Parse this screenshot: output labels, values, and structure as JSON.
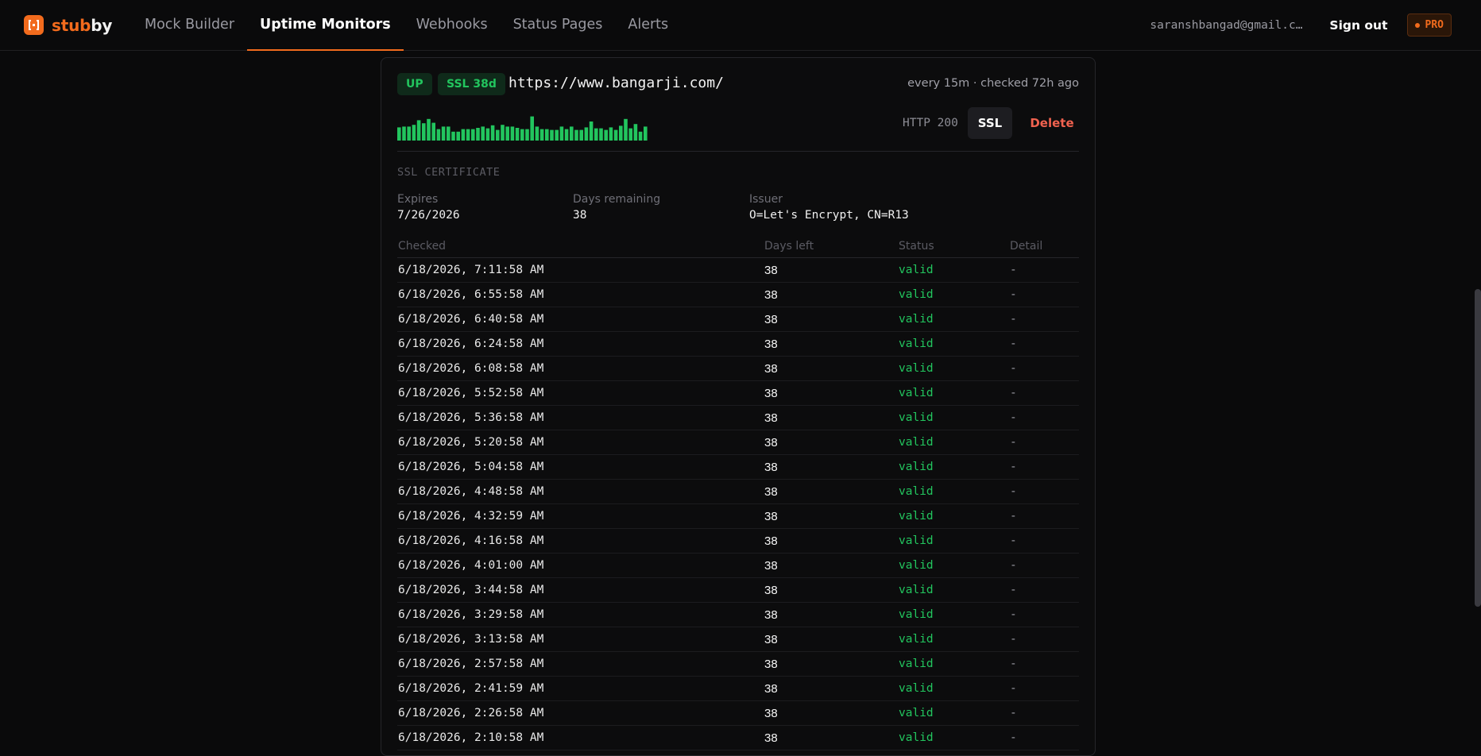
{
  "brand": {
    "part_a": "stub",
    "part_b": "by",
    "logo_icon": "bracket-logo-icon"
  },
  "nav": {
    "tabs": [
      {
        "label": "Mock Builder",
        "active": false
      },
      {
        "label": "Uptime Monitors",
        "active": true
      },
      {
        "label": "Webhooks",
        "active": false
      },
      {
        "label": "Status Pages",
        "active": false
      },
      {
        "label": "Alerts",
        "active": false
      }
    ]
  },
  "user": {
    "email": "saranshbangad@gmail.com",
    "signout_label": "Sign out",
    "plan_label": "PRO"
  },
  "monitor": {
    "status": "UP",
    "ssl_badge": "SSL 38d",
    "url": "https://www.bangarji.com/",
    "meta": "every 15m · checked 72h ago",
    "http_status": "HTTP 200",
    "ssl_button": "SSL",
    "delete_button": "Delete",
    "uptime_history": [
      0.52,
      0.55,
      0.55,
      0.62,
      0.8,
      0.68,
      0.85,
      0.7,
      0.45,
      0.55,
      0.55,
      0.35,
      0.35,
      0.45,
      0.45,
      0.45,
      0.5,
      0.55,
      0.48,
      0.6,
      0.42,
      0.62,
      0.55,
      0.55,
      0.5,
      0.45,
      0.45,
      0.95,
      0.55,
      0.45,
      0.45,
      0.42,
      0.42,
      0.55,
      0.45,
      0.55,
      0.42,
      0.42,
      0.52,
      0.75,
      0.48,
      0.48,
      0.42,
      0.52,
      0.42,
      0.58,
      0.85,
      0.48,
      0.65,
      0.35,
      0.55
    ]
  },
  "ssl": {
    "section_title": "SSL CERTIFICATE",
    "expires_label": "Expires",
    "expires_value": "7/26/2026",
    "days_label": "Days remaining",
    "days_value": "38",
    "issuer_label": "Issuer",
    "issuer_value": "O=Let's Encrypt, CN=R13"
  },
  "history": {
    "columns": [
      "Checked",
      "Days left",
      "Status",
      "Detail"
    ],
    "rows": [
      {
        "checked": "6/18/2026, 7:11:58 AM",
        "days": "38",
        "status": "valid",
        "detail": "-"
      },
      {
        "checked": "6/18/2026, 6:55:58 AM",
        "days": "38",
        "status": "valid",
        "detail": "-"
      },
      {
        "checked": "6/18/2026, 6:40:58 AM",
        "days": "38",
        "status": "valid",
        "detail": "-"
      },
      {
        "checked": "6/18/2026, 6:24:58 AM",
        "days": "38",
        "status": "valid",
        "detail": "-"
      },
      {
        "checked": "6/18/2026, 6:08:58 AM",
        "days": "38",
        "status": "valid",
        "detail": "-"
      },
      {
        "checked": "6/18/2026, 5:52:58 AM",
        "days": "38",
        "status": "valid",
        "detail": "-"
      },
      {
        "checked": "6/18/2026, 5:36:58 AM",
        "days": "38",
        "status": "valid",
        "detail": "-"
      },
      {
        "checked": "6/18/2026, 5:20:58 AM",
        "days": "38",
        "status": "valid",
        "detail": "-"
      },
      {
        "checked": "6/18/2026, 5:04:58 AM",
        "days": "38",
        "status": "valid",
        "detail": "-"
      },
      {
        "checked": "6/18/2026, 4:48:58 AM",
        "days": "38",
        "status": "valid",
        "detail": "-"
      },
      {
        "checked": "6/18/2026, 4:32:59 AM",
        "days": "38",
        "status": "valid",
        "detail": "-"
      },
      {
        "checked": "6/18/2026, 4:16:58 AM",
        "days": "38",
        "status": "valid",
        "detail": "-"
      },
      {
        "checked": "6/18/2026, 4:01:00 AM",
        "days": "38",
        "status": "valid",
        "detail": "-"
      },
      {
        "checked": "6/18/2026, 3:44:58 AM",
        "days": "38",
        "status": "valid",
        "detail": "-"
      },
      {
        "checked": "6/18/2026, 3:29:58 AM",
        "days": "38",
        "status": "valid",
        "detail": "-"
      },
      {
        "checked": "6/18/2026, 3:13:58 AM",
        "days": "38",
        "status": "valid",
        "detail": "-"
      },
      {
        "checked": "6/18/2026, 2:57:58 AM",
        "days": "38",
        "status": "valid",
        "detail": "-"
      },
      {
        "checked": "6/18/2026, 2:41:59 AM",
        "days": "38",
        "status": "valid",
        "detail": "-"
      },
      {
        "checked": "6/18/2026, 2:26:58 AM",
        "days": "38",
        "status": "valid",
        "detail": "-"
      },
      {
        "checked": "6/18/2026, 2:10:58 AM",
        "days": "38",
        "status": "valid",
        "detail": "-"
      }
    ]
  },
  "colors": {
    "accent": "#f26b1d",
    "success": "#22c55e",
    "danger": "#f0624f",
    "background": "#0a0a0b"
  }
}
